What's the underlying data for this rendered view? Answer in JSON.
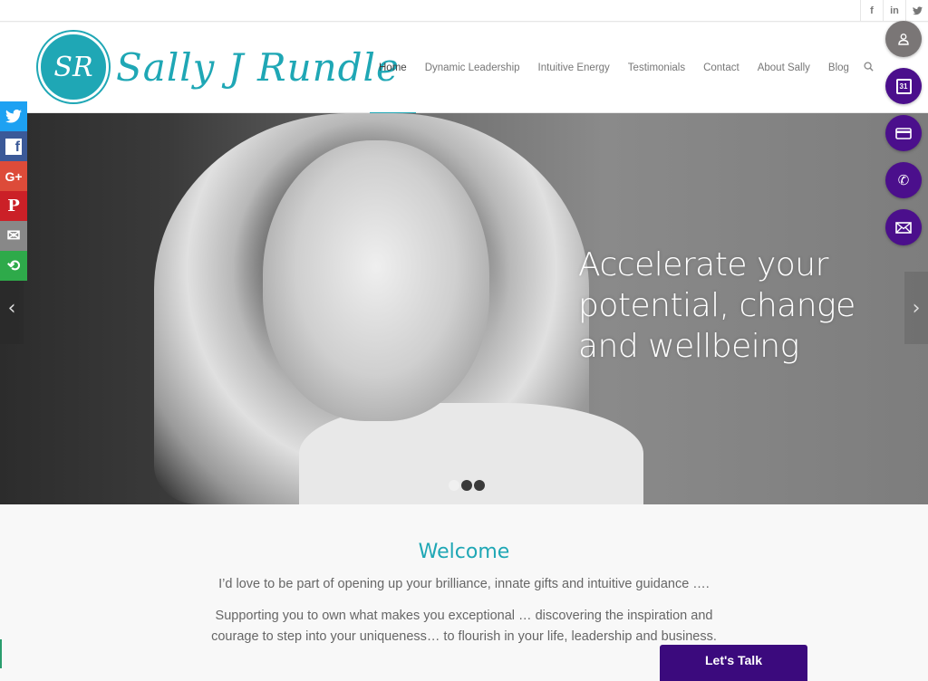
{
  "topbar": {
    "social": [
      {
        "icon": "facebook-icon",
        "glyph": "f"
      },
      {
        "icon": "linkedin-icon",
        "glyph": "in"
      },
      {
        "icon": "twitter-icon",
        "glyph": "🐦"
      }
    ]
  },
  "header": {
    "logo_monogram": "SR",
    "logo_text": "Sally J Rundle",
    "nav": [
      {
        "label": "Home",
        "active": true
      },
      {
        "label": "Dynamic Leadership"
      },
      {
        "label": "Intuitive Energy"
      },
      {
        "label": "Testimonials"
      },
      {
        "label": "Contact"
      },
      {
        "label": "About Sally"
      },
      {
        "label": "Blog"
      }
    ],
    "search_glyph": "⚲"
  },
  "hero": {
    "caption": "Accelerate your potential, change and wellbeing",
    "prev_glyph": "‹",
    "next_glyph": "›",
    "slides": 3,
    "active_slide": 1
  },
  "share_bar": [
    {
      "name": "twitter",
      "glyph": "🐦",
      "color": "#1da1f2"
    },
    {
      "name": "facebook",
      "glyph": "f",
      "color": "#3b5998"
    },
    {
      "name": "google-plus",
      "glyph": "G+",
      "color": "#dd4b39"
    },
    {
      "name": "pinterest",
      "glyph": "P",
      "color": "#cb2027"
    },
    {
      "name": "email",
      "glyph": "✉",
      "color": "#888888"
    },
    {
      "name": "more",
      "glyph": "⟲",
      "color": "#2eaa4a"
    }
  ],
  "floating_actions": [
    {
      "name": "account",
      "glyph": "👤",
      "color": "#7a7676"
    },
    {
      "name": "calendar",
      "glyph": "31",
      "color": "#4b0f8c"
    },
    {
      "name": "payment",
      "glyph": "▭",
      "color": "#4b0f8c"
    },
    {
      "name": "phone",
      "glyph": "✆",
      "color": "#4b0f8c"
    },
    {
      "name": "email",
      "glyph": "✉",
      "color": "#4b0f8c"
    }
  ],
  "welcome": {
    "title": "Welcome",
    "line1": "I’d love to be part of opening up your brilliance, innate gifts and intuitive guidance ….",
    "line2": "Supporting you to own what makes you exceptional … discovering the inspiration and courage to step into your uniqueness… to flourish in your life, leadership and business."
  },
  "cta": {
    "label": "Let's Talk"
  },
  "colors": {
    "accent": "#1fa7b5",
    "purple": "#4b0f8c"
  }
}
